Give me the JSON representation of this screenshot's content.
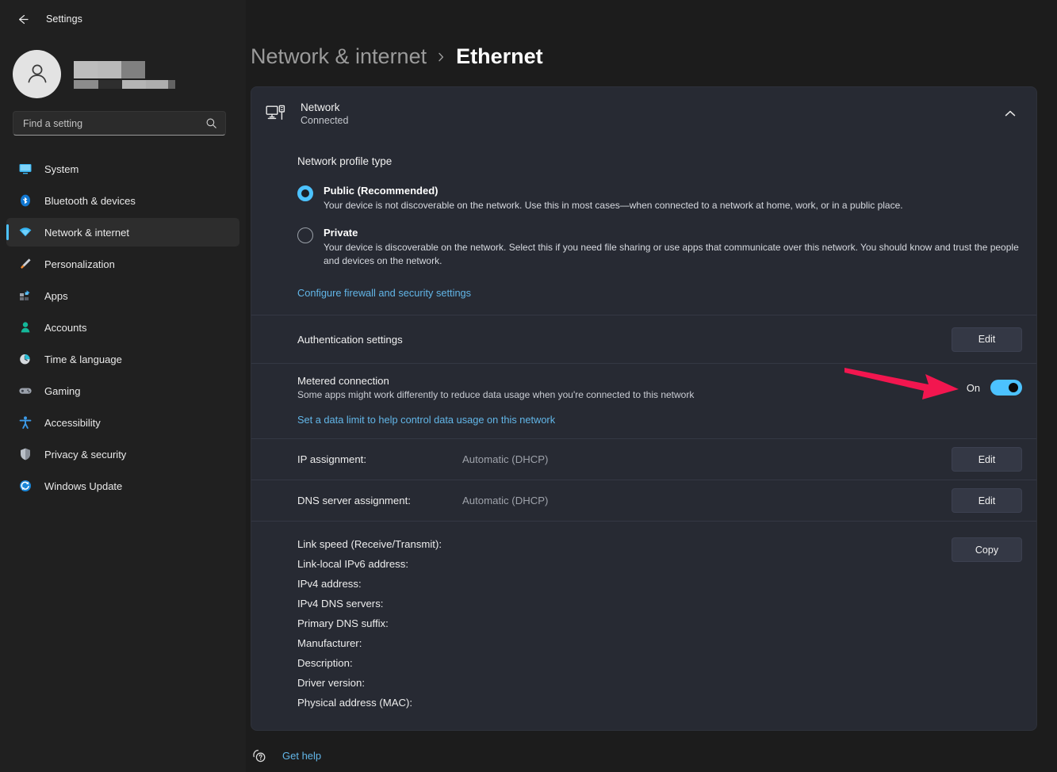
{
  "titlebar": {
    "back_label": "back-arrow",
    "title": "Settings"
  },
  "account": {
    "name_redacted": true
  },
  "search": {
    "placeholder": "Find a setting",
    "value": ""
  },
  "sidebar": {
    "items": [
      {
        "label": "System",
        "icon": "monitor-icon",
        "active": false
      },
      {
        "label": "Bluetooth & devices",
        "icon": "bluetooth-icon",
        "active": false
      },
      {
        "label": "Network & internet",
        "icon": "wifi-icon",
        "active": true
      },
      {
        "label": "Personalization",
        "icon": "brush-icon",
        "active": false
      },
      {
        "label": "Apps",
        "icon": "apps-icon",
        "active": false
      },
      {
        "label": "Accounts",
        "icon": "person-icon",
        "active": false
      },
      {
        "label": "Time & language",
        "icon": "clock-icon",
        "active": false
      },
      {
        "label": "Gaming",
        "icon": "gamepad-icon",
        "active": false
      },
      {
        "label": "Accessibility",
        "icon": "accessibility-icon",
        "active": false
      },
      {
        "label": "Privacy & security",
        "icon": "shield-icon",
        "active": false
      },
      {
        "label": "Windows Update",
        "icon": "update-icon",
        "active": false
      }
    ]
  },
  "breadcrumb": {
    "root": "Network & internet",
    "separator": "chevron-right-icon",
    "leaf": "Ethernet"
  },
  "network_card": {
    "icon": "ethernet-pc-icon",
    "title": "Network",
    "status": "Connected",
    "collapse_icon": "chevron-up-icon"
  },
  "profile": {
    "section_title": "Network profile type",
    "options": [
      {
        "label": "Public (Recommended)",
        "description": "Your device is not discoverable on the network. Use this in most cases—when connected to a network at home, work, or in a public place.",
        "selected": true
      },
      {
        "label": "Private",
        "description": "Your device is discoverable on the network. Select this if you need file sharing or use apps that communicate over this network. You should know and trust the people and devices on the network.",
        "selected": false
      }
    ],
    "firewall_link": "Configure firewall and security settings"
  },
  "authentication": {
    "title": "Authentication settings",
    "button": "Edit"
  },
  "metered": {
    "title": "Metered connection",
    "description": "Some apps might work differently to reduce data usage when you're connected to this network",
    "toggle_state": "On",
    "toggle_on": true,
    "data_limit_link": "Set a data limit to help control data usage on this network"
  },
  "assignments": [
    {
      "key": "IP assignment:",
      "value": "Automatic (DHCP)",
      "button": "Edit"
    },
    {
      "key": "DNS server assignment:",
      "value": "Automatic (DHCP)",
      "button": "Edit"
    }
  ],
  "properties": {
    "copy_button": "Copy",
    "lines": [
      {
        "key": "Link speed (Receive/Transmit):",
        "value": ""
      },
      {
        "key": "Link-local IPv6 address:",
        "value": ""
      },
      {
        "key": "IPv4 address:",
        "value": ""
      },
      {
        "key": "IPv4 DNS servers:",
        "value": ""
      },
      {
        "key": "Primary DNS suffix:",
        "value": ""
      },
      {
        "key": "Manufacturer:",
        "value": ""
      },
      {
        "key": "Description:",
        "value": ""
      },
      {
        "key": "Driver version:",
        "value": ""
      },
      {
        "key": "Physical address (MAC):",
        "value": ""
      }
    ]
  },
  "footer": {
    "help_icon": "help-question-icon",
    "help_label": "Get help"
  },
  "annotation": {
    "type": "arrow",
    "color": "#f2164f",
    "points_to": "metered-connection-toggle"
  },
  "colors": {
    "accent": "#4cc2ff",
    "link": "#62b6e8",
    "card_bg": "#272a33",
    "sidebar_bg": "#202020",
    "content_bg": "#1c1c1c",
    "annotation": "#f2164f"
  }
}
